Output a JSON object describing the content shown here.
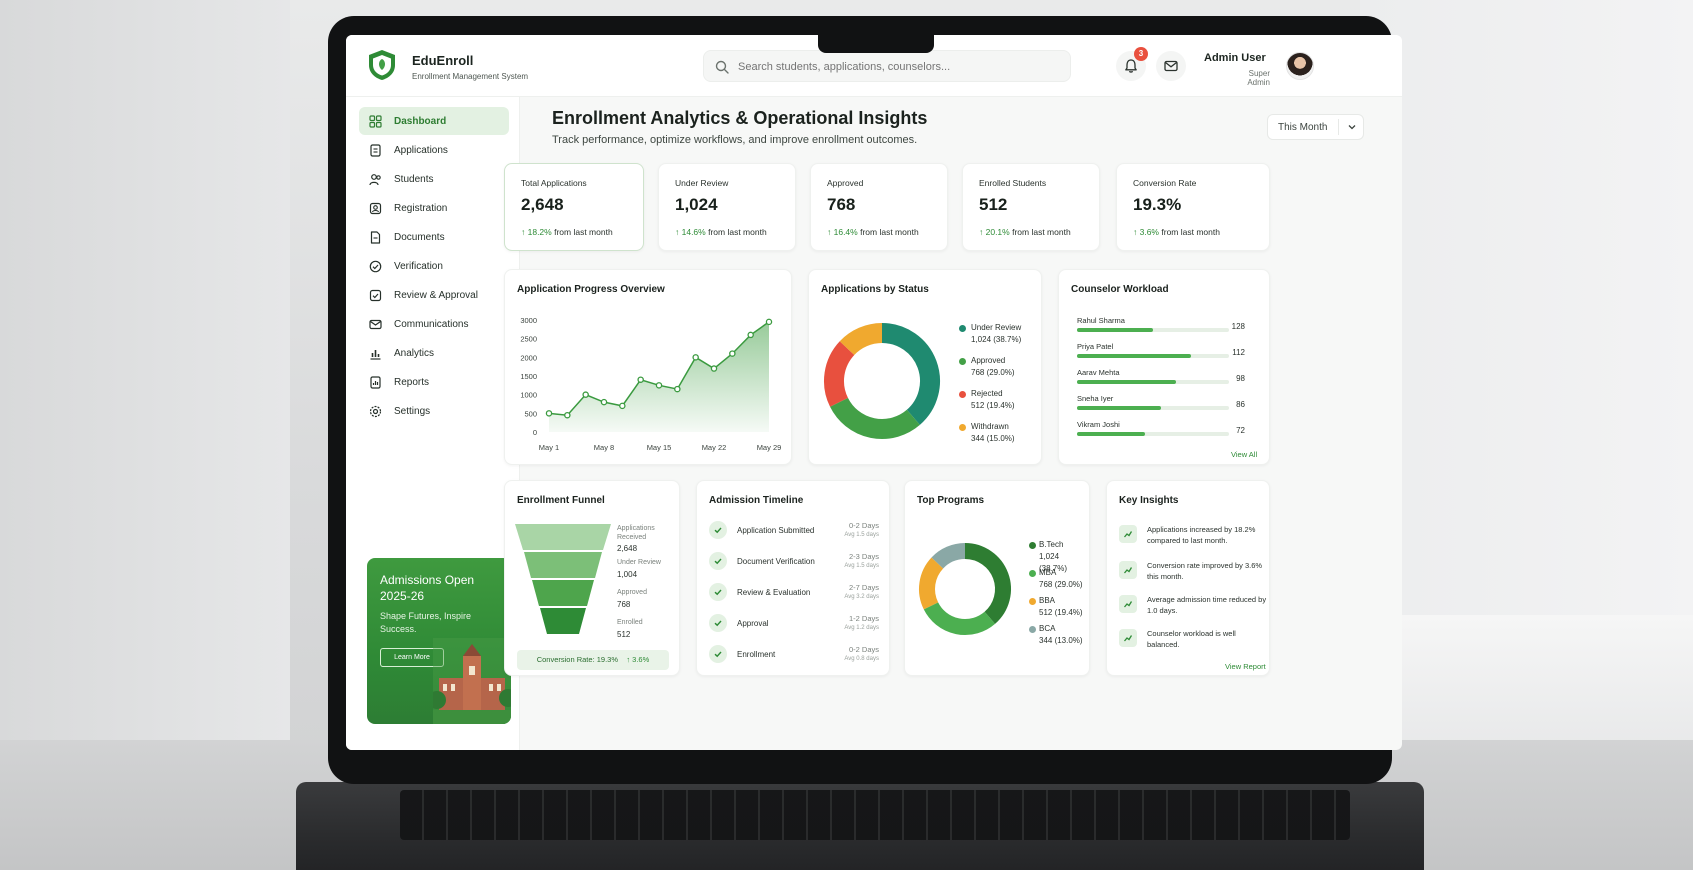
{
  "brand": {
    "name": "EduEnroll",
    "subtitle": "Enrollment Management System"
  },
  "search": {
    "placeholder": "Search students, applications, counselors..."
  },
  "notifications": {
    "count": "3"
  },
  "user": {
    "name": "Admin User",
    "role": "Super Admin"
  },
  "sidebar": {
    "items": [
      {
        "label": "Dashboard",
        "icon": "dashboard-icon",
        "active": true
      },
      {
        "label": "Applications",
        "icon": "applications-icon"
      },
      {
        "label": "Students",
        "icon": "students-icon"
      },
      {
        "label": "Registration",
        "icon": "registration-icon"
      },
      {
        "label": "Documents",
        "icon": "documents-icon"
      },
      {
        "label": "Verification",
        "icon": "verification-icon"
      },
      {
        "label": "Review & Approval",
        "icon": "review-icon"
      },
      {
        "label": "Communications",
        "icon": "mail-icon"
      },
      {
        "label": "Analytics",
        "icon": "analytics-icon"
      },
      {
        "label": "Reports",
        "icon": "reports-icon"
      },
      {
        "label": "Settings",
        "icon": "settings-icon"
      }
    ]
  },
  "promo": {
    "title": "Admissions Open 2025-26",
    "subtitle": "Shape Futures, Inspire Success.",
    "button": "Learn More"
  },
  "header": {
    "title": "Enrollment Analytics & Operational Insights",
    "subtitle": "Track performance, optimize workflows, and improve enrollment outcomes.",
    "period": "This Month"
  },
  "kpis": [
    {
      "label": "Total Applications",
      "value": "2,648",
      "delta": "↑ 18.2%",
      "delta_text": "from last month"
    },
    {
      "label": "Under Review",
      "value": "1,024",
      "delta": "↑ 14.6%",
      "delta_text": "from last month"
    },
    {
      "label": "Approved",
      "value": "768",
      "delta": "↑ 16.4%",
      "delta_text": "from last month"
    },
    {
      "label": "Enrolled Students",
      "value": "512",
      "delta": "↑ 20.1%",
      "delta_text": "from last month"
    },
    {
      "label": "Conversion Rate",
      "value": "19.3%",
      "delta": "↑ 3.6%",
      "delta_text": "from last month"
    }
  ],
  "progress": {
    "title": "Application Progress Overview",
    "y_ticks": [
      "3000",
      "2500",
      "2000",
      "1500",
      "1000",
      "500",
      "0"
    ],
    "x_ticks": [
      "May 1",
      "May 8",
      "May 15",
      "May 22",
      "May 29"
    ]
  },
  "status": {
    "title": "Applications by Status",
    "items": [
      {
        "name": "Under Review",
        "value": "1,024 (38.7%)",
        "color": "#1f8a70"
      },
      {
        "name": "Approved",
        "value": "768 (29.0%)",
        "color": "#43a047"
      },
      {
        "name": "Rejected",
        "value": "512 (19.4%)",
        "color": "#e8503e"
      },
      {
        "name": "Withdrawn",
        "value": "344 (15.0%)",
        "color": "#f0a92f"
      }
    ]
  },
  "workload": {
    "title": "Counselor Workload",
    "items": [
      {
        "name": "Rahul Sharma",
        "value": "128",
        "fraction": 0.5
      },
      {
        "name": "Priya Patel",
        "value": "112",
        "fraction": 0.75
      },
      {
        "name": "Aarav Mehta",
        "value": "98",
        "fraction": 0.65
      },
      {
        "name": "Sneha Iyer",
        "value": "86",
        "fraction": 0.55
      },
      {
        "name": "Vikram Joshi",
        "value": "72",
        "fraction": 0.45
      }
    ],
    "link": "View All"
  },
  "funnel": {
    "title": "Enrollment Funnel",
    "stages": [
      {
        "label": "Applications Received",
        "value": "2,648"
      },
      {
        "label": "Under Review",
        "value": "1,004"
      },
      {
        "label": "Approved",
        "value": "768"
      },
      {
        "label": "Enrolled",
        "value": "512"
      }
    ],
    "rate": "Conversion Rate: 19.3%",
    "rate_delta": "↑ 3.6%"
  },
  "timeline": {
    "title": "Admission Timeline",
    "items": [
      {
        "label": "Application Submitted",
        "days": "0-2 Days",
        "sub": "Avg 1.5 days"
      },
      {
        "label": "Document Verification",
        "days": "2-3 Days",
        "sub": "Avg 1.5 days"
      },
      {
        "label": "Review & Evaluation",
        "days": "2-7 Days",
        "sub": "Avg 3.2 days"
      },
      {
        "label": "Approval",
        "days": "1-2 Days",
        "sub": "Avg 1.2 days"
      },
      {
        "label": "Enrollment",
        "days": "0-2 Days",
        "sub": "Avg 0.8 days"
      }
    ]
  },
  "programs": {
    "title": "Top Programs",
    "items": [
      {
        "name": "B.Tech",
        "value": "1,024 (38.7%)",
        "color": "#2e7d32"
      },
      {
        "name": "MBA",
        "value": "768 (29.0%)",
        "color": "#4caf50"
      },
      {
        "name": "BBA",
        "value": "512 (19.4%)",
        "color": "#f0a92f"
      },
      {
        "name": "BCA",
        "value": "344 (13.0%)",
        "color": "#8aa8a6"
      }
    ]
  },
  "insights": {
    "title": "Key Insights",
    "items": [
      {
        "text": "Applications increased by 18.2% compared to last month."
      },
      {
        "text": "Conversion rate improved by 3.6% this month."
      },
      {
        "text": "Average admission time reduced by 1.0 days."
      },
      {
        "text": "Counselor workload is well balanced."
      }
    ],
    "link": "View Report"
  },
  "chart_data": [
    {
      "type": "area",
      "title": "Application Progress Overview",
      "x": [
        "May 1",
        "May 3",
        "May 6",
        "May 8",
        "May 10",
        "May 13",
        "May 15",
        "May 18",
        "May 20",
        "May 22",
        "May 25",
        "May 27",
        "May 29"
      ],
      "values": [
        500,
        450,
        1000,
        800,
        700,
        1400,
        1250,
        1150,
        2000,
        1700,
        2100,
        2600,
        2950
      ],
      "ylim": [
        0,
        3000
      ],
      "grid": false
    },
    {
      "type": "pie",
      "title": "Applications by Status",
      "categories": [
        "Under Review",
        "Approved",
        "Rejected",
        "Withdrawn"
      ],
      "values": [
        1024,
        768,
        512,
        344
      ],
      "colors": [
        "#1f8a70",
        "#43a047",
        "#e8503e",
        "#f0a92f"
      ],
      "legend": "right"
    },
    {
      "type": "pie",
      "title": "Top Programs",
      "categories": [
        "B.Tech",
        "MBA",
        "BBA",
        "BCA"
      ],
      "values": [
        1024,
        768,
        512,
        344
      ],
      "colors": [
        "#2e7d32",
        "#4caf50",
        "#f0a92f",
        "#8aa8a6"
      ],
      "legend": "right"
    }
  ]
}
